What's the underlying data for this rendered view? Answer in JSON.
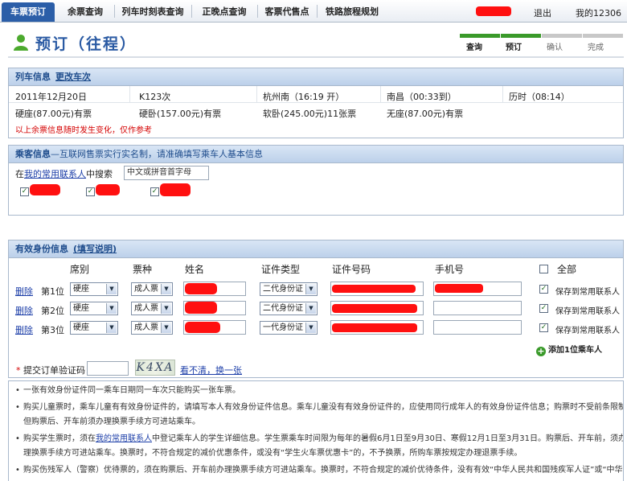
{
  "nav": {
    "tabs": [
      "车票预订",
      "余票查询",
      "列车时刻表查询",
      "正晚点查询",
      "客票代售点",
      "铁路旅程规划"
    ],
    "logout": "退出",
    "my12306": "我的12306"
  },
  "page": {
    "title": "预订（往程）"
  },
  "steps": [
    "查询",
    "预订",
    "确认",
    "完成"
  ],
  "train": {
    "header": "列车信息",
    "change_link": "更改车次",
    "date": "2011年12月20日",
    "train_no": "K123次",
    "from": "杭州南（16:19 开）",
    "to": "南昌（00:33到）",
    "duration": "历时（08:14）",
    "seats": [
      "硬座(87.00元)有票",
      "硬卧(157.00元)有票",
      "软卧(245.00元)11张票",
      "无座(87.00元)有票"
    ],
    "note": "以上余票信息随时发生变化，仅作参考"
  },
  "passenger": {
    "header": "乘客信息",
    "header_note": "—互联网售票实行实名制，请准确填写乘车人基本信息",
    "search_prefix": "在",
    "search_link": "我的常用联系人",
    "search_suffix": "中搜索",
    "search_placeholder": "中文或拼音首字母"
  },
  "ids": {
    "header": "有效身份信息",
    "help_link": "(填写说明)",
    "columns": [
      "席别",
      "票种",
      "姓名",
      "证件类型",
      "证件号码",
      "手机号",
      "全部"
    ],
    "rows": [
      {
        "delete": "删除",
        "seq": "第1位",
        "seat": "硬座",
        "ticket": "成人票",
        "id_type": "二代身份证",
        "save": "保存到常用联系人"
      },
      {
        "delete": "删除",
        "seq": "第2位",
        "seat": "硬座",
        "ticket": "成人票",
        "id_type": "二代身份证",
        "save": "保存到常用联系人"
      },
      {
        "delete": "删除",
        "seq": "第3位",
        "seat": "硬座",
        "ticket": "成人票",
        "id_type": "一代身份证",
        "save": "保存到常用联系人"
      }
    ],
    "add_passenger": "添加1位乘车人",
    "captcha_label": "提交订单验证码：",
    "captcha_code": "K4XA",
    "captcha_refresh": "看不清，换一张"
  },
  "notes": [
    "一张有效身份证件同一乘车日期同一车次只能购买一张车票。",
    "购买儿童票时，乘车儿童有有效身份证件的，请填写本人有效身份证件信息。乘车儿童没有有效身份证件的，应使用同行成年人的有效身份证件信息；购票时不受前条限制，",
    "但购票后、开车前须办理换票手续方可进站乘车。",
    "购买学生票时，须在",
    "我的常用联系人",
    "中登记乘车人的学生详细信息。学生票乘车时间限为每年的暑假6月1日至9月30日、寒假12月1日至3月31日。购票后、开车前，须办",
    "理换票手续方可进站乘车。换票时，不符合规定的减价优惠条件，或没有“学生火车票优惠卡”的，不予换票，所购车票按规定办理退票手续。",
    "购买伤残军人（警察）优待票的，须在购票后、开车前办理换票手续方可进站乘车。换票时，不符合规定的减价优待条件，没有有效“中华人民共和国残疾军人证”或“中华"
  ],
  "colors": {
    "nav_active": "#2b5ea8",
    "title": "#2a5aa3",
    "step_done": "#3a9a2a",
    "step_todo": "#c8c8c8",
    "redaction": "#ff1010"
  }
}
